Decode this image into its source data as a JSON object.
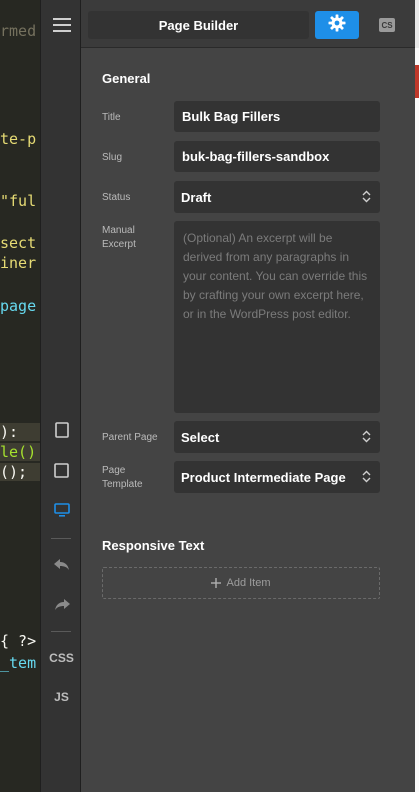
{
  "code_fragments": [
    {
      "text": "rmed",
      "color": "#75715e"
    },
    {
      "text": "te-p",
      "color": "#e6db74"
    },
    {
      "text": "\"ful",
      "color": "#e6db74"
    },
    {
      "text": "sect",
      "color": "#e6db74"
    },
    {
      "text": "iner",
      "color": "#e6db74"
    },
    {
      "text": "page",
      "color": "#66d9ef"
    },
    {
      "text": "):",
      "color": "#f8f8f2"
    },
    {
      "text": "le()",
      "color": "#a6e22e"
    },
    {
      "text": "();",
      "color": "#f8f8f2"
    },
    {
      "text": "{ ?>",
      "color": "#f8f8f2"
    },
    {
      "text": "_tem",
      "color": "#66d9ef"
    }
  ],
  "toolbar": {
    "menu_icon": "hamburger-icon",
    "items": [
      {
        "name": "tablet-icon"
      },
      {
        "name": "square-icon"
      },
      {
        "name": "desktop-icon",
        "active": true
      },
      {
        "name": "undo-icon"
      },
      {
        "name": "redo-icon"
      }
    ],
    "css_label": "CSS",
    "js_label": "JS"
  },
  "header": {
    "title": "Page Builder",
    "settings_icon": "gear-icon",
    "css_icon": "css-badge-icon",
    "css_badge": "CS"
  },
  "general": {
    "heading": "General",
    "title_label": "Title",
    "title_value": "Bulk Bag Fillers",
    "slug_label": "Slug",
    "slug_value": "buk-bag-fillers-sandbox",
    "status_label": "Status",
    "status_value": "Draft",
    "excerpt_label_1": "Manual",
    "excerpt_label_2": "Excerpt",
    "excerpt_placeholder": "(Optional) An excerpt will be derived from any paragraphs in your content. You can override this by crafting your own excerpt here, or in the WordPress post editor.",
    "parent_label": "Parent Page",
    "parent_value": "Select",
    "template_label_1": "Page",
    "template_label_2": "Template",
    "template_value": "Product Intermediate Page"
  },
  "responsive": {
    "heading": "Responsive Text",
    "add_label": "Add Item"
  },
  "colors": {
    "accent": "#1e8fe8",
    "panel": "#444444",
    "field": "#333333"
  }
}
